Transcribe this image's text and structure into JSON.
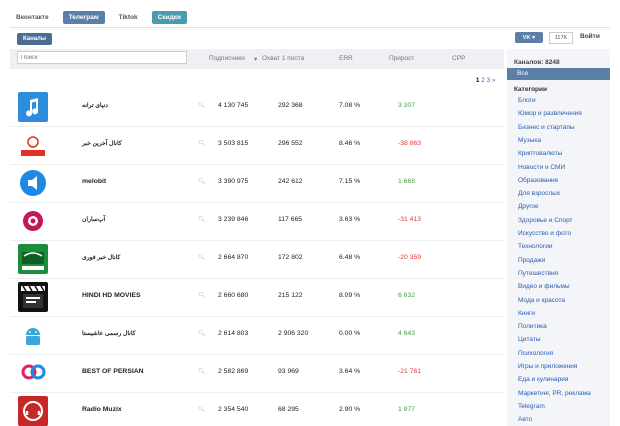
{
  "top_tabs": [
    "Вконтакте",
    "Телеграм",
    "Tiktok",
    "Скидки"
  ],
  "channels_button": "Каналы",
  "vk_button": "VK ♥",
  "vk_count": "117K",
  "login": "Войти",
  "search_placeholder": "Поиск",
  "columns": {
    "subscribers": "Подписчики",
    "reach": "Охват 1 поста",
    "err": "ERR",
    "growth": "Прирост",
    "cpp": "CPP"
  },
  "pager": [
    "1",
    "2",
    "3",
    "»"
  ],
  "rows": [
    {
      "name": "دنیای ترانه",
      "subs": "4 130 745",
      "reach": "292 368",
      "err": "7.08 %",
      "growth": "3 307",
      "sign": "pos",
      "logo": "music-note-logo"
    },
    {
      "name": "کانال آخرین خبر",
      "subs": "3 503 815",
      "reach": "296 552",
      "err": "8.46 %",
      "growth": "-38 863",
      "sign": "neg",
      "logo": "akharin-khabar-logo"
    },
    {
      "name": "melobit",
      "subs": "3 390 975",
      "reach": "242 612",
      "err": "7.15 %",
      "growth": "1 668",
      "sign": "pos",
      "logo": "melobit-logo"
    },
    {
      "name": "آپ‌ساران",
      "subs": "3 239 846",
      "reach": "117 665",
      "err": "3.63 %",
      "growth": "-31 413",
      "sign": "neg",
      "logo": "apsaran-logo"
    },
    {
      "name": "کانال خبر فوری",
      "subs": "2 664 870",
      "reach": "172 802",
      "err": "6.48 %",
      "growth": "-20 359",
      "sign": "neg",
      "logo": "khabar-fori-logo"
    },
    {
      "name": "HINDI HD MOVIES",
      "subs": "2 660 680",
      "reach": "215 122",
      "err": "8.09 %",
      "growth": "6 632",
      "sign": "pos",
      "logo": "hindi-movies-logo"
    },
    {
      "name": "کانال رسمی عاشیستا",
      "subs": "2 614 803",
      "reach": "2 906 320",
      "err": "0.00 %",
      "growth": "4 643",
      "sign": "pos",
      "logo": "android-logo"
    },
    {
      "name": "BEST OF PERSIAN",
      "subs": "2 582 869",
      "reach": "93 969",
      "err": "3.64 %",
      "growth": "-21 761",
      "sign": "neg",
      "logo": "best-of-persian-logo"
    },
    {
      "name": "Radio Muzix",
      "subs": "2 354 540",
      "reach": "68 295",
      "err": "2.90 %",
      "growth": "1 977",
      "sign": "pos",
      "logo": "radio-muzix-logo"
    }
  ],
  "sidebar": {
    "count_label": "Каналов: 8248",
    "all": "Все",
    "categories_title": "Категории",
    "categories": [
      "Блоги",
      "Юмор и развлечения",
      "Бизнес и стартапы",
      "Музыка",
      "Криптовалюты",
      "Новости и СМИ",
      "Образование",
      "Для взрослых",
      "Другое",
      "Здоровье и Спорт",
      "Искусство и фото",
      "Технологии",
      "Продажи",
      "Путешествия",
      "Видео и фильмы",
      "Мода и красота",
      "Книги",
      "Политика",
      "Цитаты",
      "Психология",
      "Игры и приложения",
      "Еда и кулинария",
      "Маркетинг, PR, реклама",
      "Telegram",
      "Авто"
    ]
  },
  "colors": {
    "accent": "#5a7fa8",
    "positive": "#43a047",
    "negative": "#e53935"
  }
}
